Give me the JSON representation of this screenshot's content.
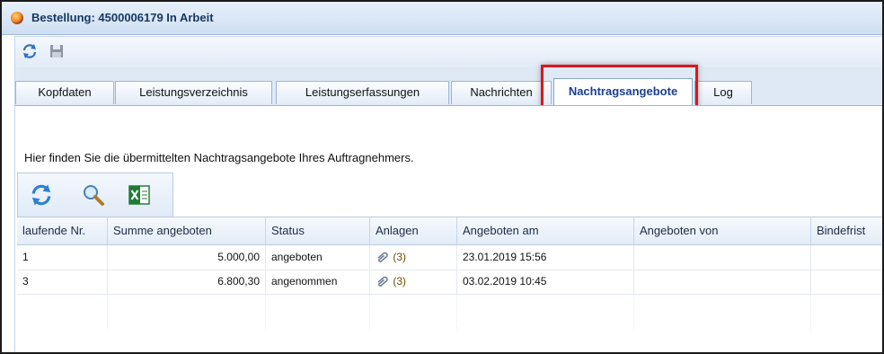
{
  "window": {
    "title": "Bestellung: 4500006179 In Arbeit"
  },
  "toolbar": {
    "icons": [
      "refresh-icon",
      "save-icon"
    ]
  },
  "tabs": [
    {
      "label": "Kopfdaten",
      "active": false
    },
    {
      "label": "Leistungsverzeichnis",
      "active": false
    },
    {
      "label": "Leistungserfassungen",
      "active": false
    },
    {
      "label": "Nachrichten",
      "active": false
    },
    {
      "label": "Nachtragsangebote",
      "active": true
    },
    {
      "label": "Log",
      "active": false
    }
  ],
  "content": {
    "info_text": "Hier finden Sie die übermittelten Nachtragsangebote Ihres Auftragnehmers.",
    "grid_toolbar_icons": [
      "refresh-icon",
      "search-icon",
      "excel-export-icon"
    ]
  },
  "table": {
    "columns": [
      "laufende Nr.",
      "Summe angeboten",
      "Status",
      "Anlagen",
      "Angeboten am",
      "Angeboten von",
      "Bindefrist"
    ],
    "rows": [
      {
        "nr": "1",
        "summe": "5.000,00",
        "status": "angeboten",
        "anlagen": "(3)",
        "angeboten_am": "23.01.2019 15:56",
        "angeboten_von": "",
        "bindefrist": ""
      },
      {
        "nr": "3",
        "summe": "6.800,30",
        "status": "angenommen",
        "anlagen": "(3)",
        "angeboten_am": "03.02.2019 10:45",
        "angeboten_von": "",
        "bindefrist": ""
      }
    ]
  },
  "colors": {
    "highlight_box": "#e0141b",
    "active_tab_text": "#1b3f8f",
    "title_text": "#15375f"
  }
}
